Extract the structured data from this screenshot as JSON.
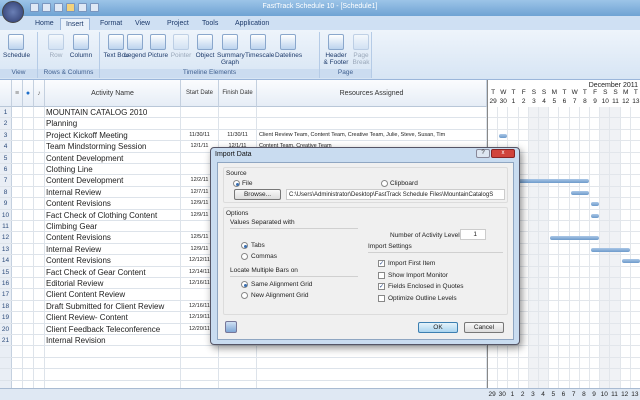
{
  "window": {
    "title": "FastTrack Schedule 10 - [Schedule1]"
  },
  "tabs": [
    "Home",
    "Insert",
    "Format",
    "View",
    "Project",
    "Tools",
    "Application"
  ],
  "active_tab": "Insert",
  "ribbon": {
    "groups": [
      {
        "label": "View",
        "buttons": [
          {
            "label": "Schedule",
            "enabled": true
          }
        ]
      },
      {
        "label": "Rows & Columns",
        "buttons": [
          {
            "label": "Row",
            "enabled": false
          },
          {
            "label": "Column",
            "enabled": true
          }
        ]
      },
      {
        "label": "Timeline Elements",
        "buttons": [
          {
            "label": "Text Box",
            "enabled": true
          },
          {
            "label": "Legend",
            "enabled": true
          },
          {
            "label": "Picture",
            "enabled": true
          },
          {
            "label": "Pointer",
            "enabled": false
          },
          {
            "label": "Object",
            "enabled": true
          },
          {
            "label": "Summary Graph",
            "enabled": true
          },
          {
            "label": "Timescale",
            "enabled": true
          },
          {
            "label": "Datelines",
            "enabled": true
          }
        ]
      },
      {
        "label": "Page",
        "buttons": [
          {
            "label": "Header & Footer",
            "enabled": true
          },
          {
            "label": "Page Break",
            "enabled": false
          }
        ]
      }
    ]
  },
  "grid": {
    "headers": {
      "activity": "Activity Name",
      "start": "Start Date",
      "finish": "Finish Date",
      "resources": "Resources Assigned"
    },
    "rows": [
      {
        "n": "1",
        "name": "MOUNTAIN CATALOG 2010",
        "start": "",
        "finish": "",
        "res": ""
      },
      {
        "n": "2",
        "name": "Planning",
        "start": "",
        "finish": "",
        "res": ""
      },
      {
        "n": "3",
        "name": "Project Kickoff Meeting",
        "start": "11/30/11",
        "finish": "11/30/11",
        "res": "Client Review Team, Content Team, Creative Team, Julie, Steve, Susan, Tim"
      },
      {
        "n": "4",
        "name": "Team Mindstorming Session",
        "start": "12/1/11",
        "finish": "12/1/11",
        "res": "Content Team, Creative Team"
      },
      {
        "n": "5",
        "name": "Content Development",
        "start": "",
        "finish": "",
        "res": ""
      },
      {
        "n": "6",
        "name": "Clothing Line",
        "start": "",
        "finish": "",
        "res": ""
      },
      {
        "n": "7",
        "name": "Content Development",
        "start": "12/2/11",
        "finish": "",
        "res": ""
      },
      {
        "n": "8",
        "name": "Internal Review",
        "start": "12/7/11",
        "finish": "",
        "res": ""
      },
      {
        "n": "9",
        "name": "Content Revisions",
        "start": "12/9/11",
        "finish": "",
        "res": ""
      },
      {
        "n": "10",
        "name": "Fact Check of Clothing Content",
        "start": "12/9/11",
        "finish": "",
        "res": ""
      },
      {
        "n": "11",
        "name": "Climbing Gear",
        "start": "",
        "finish": "",
        "res": ""
      },
      {
        "n": "12",
        "name": "Content Revisions",
        "start": "12/5/11",
        "finish": "",
        "res": ""
      },
      {
        "n": "13",
        "name": "Internal Review",
        "start": "12/9/11",
        "finish": "",
        "res": ""
      },
      {
        "n": "14",
        "name": "Content Revisions",
        "start": "12/12/11",
        "finish": "",
        "res": ""
      },
      {
        "n": "15",
        "name": "Fact Check of Gear Content",
        "start": "12/14/11",
        "finish": "",
        "res": ""
      },
      {
        "n": "16",
        "name": "Editorial Review",
        "start": "12/16/11",
        "finish": "",
        "res": ""
      },
      {
        "n": "17",
        "name": "Client Content Review",
        "start": "",
        "finish": "",
        "res": ""
      },
      {
        "n": "18",
        "name": "Draft Submitted for Client Review",
        "start": "12/16/11",
        "finish": "",
        "res": ""
      },
      {
        "n": "19",
        "name": "Client Review- Content",
        "start": "12/19/11",
        "finish": "",
        "res": ""
      },
      {
        "n": "20",
        "name": "Client Feedback Teleconference",
        "start": "12/20/11",
        "finish": "",
        "res": ""
      },
      {
        "n": "21",
        "name": "Internal Revision",
        "start": "",
        "finish": "",
        "res": ""
      }
    ]
  },
  "gantt": {
    "month": "December 2011",
    "days": [
      {
        "d": "T",
        "n": "29"
      },
      {
        "d": "W",
        "n": "30"
      },
      {
        "d": "T",
        "n": "1"
      },
      {
        "d": "F",
        "n": "2"
      },
      {
        "d": "S",
        "n": "3"
      },
      {
        "d": "S",
        "n": "4"
      },
      {
        "d": "M",
        "n": "5"
      },
      {
        "d": "T",
        "n": "6"
      },
      {
        "d": "W",
        "n": "7"
      },
      {
        "d": "T",
        "n": "8"
      },
      {
        "d": "F",
        "n": "9"
      },
      {
        "d": "S",
        "n": "10"
      },
      {
        "d": "S",
        "n": "11"
      },
      {
        "d": "M",
        "n": "12"
      },
      {
        "d": "T",
        "n": "13"
      }
    ],
    "bars": [
      {
        "row": 3,
        "from": 1,
        "to": 2
      },
      {
        "row": 7,
        "from": 2,
        "to": 10
      },
      {
        "row": 8,
        "from": 8,
        "to": 10
      },
      {
        "row": 9,
        "from": 10,
        "to": 11
      },
      {
        "row": 10,
        "from": 10,
        "to": 11
      },
      {
        "row": 12,
        "from": 6,
        "to": 11
      },
      {
        "row": 13,
        "from": 10,
        "to": 14
      },
      {
        "row": 14,
        "from": 13,
        "to": 15
      }
    ]
  },
  "dialog": {
    "title": "Import Data",
    "source_label": "Source",
    "file_label": "File",
    "clipboard_label": "Clipboard",
    "browse_label": "Browse...",
    "path": "C:\\Users\\Administrator\\Desktop\\FastTrack Schedule Files\\MountainCatalogS",
    "options_label": "Options",
    "separated_label": "Values Separated with",
    "tabs_label": "Tabs",
    "commas_label": "Commas",
    "locate_label": "Locate Multiple Bars on",
    "same_grid_label": "Same Alignment Grid",
    "new_grid_label": "New Alignment Grid",
    "levels_label": "Number of Activity Levels:",
    "levels_value": "1",
    "import_settings_label": "Import Settings",
    "checks": [
      {
        "label": "Import First Item",
        "checked": true
      },
      {
        "label": "Show Import Monitor",
        "checked": false
      },
      {
        "label": "Fields Enclosed in Quotes",
        "checked": true
      },
      {
        "label": "Optimize Outline Levels",
        "checked": false
      }
    ],
    "ok_label": "OK",
    "cancel_label": "Cancel",
    "help_label": "?",
    "close_label": "x"
  }
}
